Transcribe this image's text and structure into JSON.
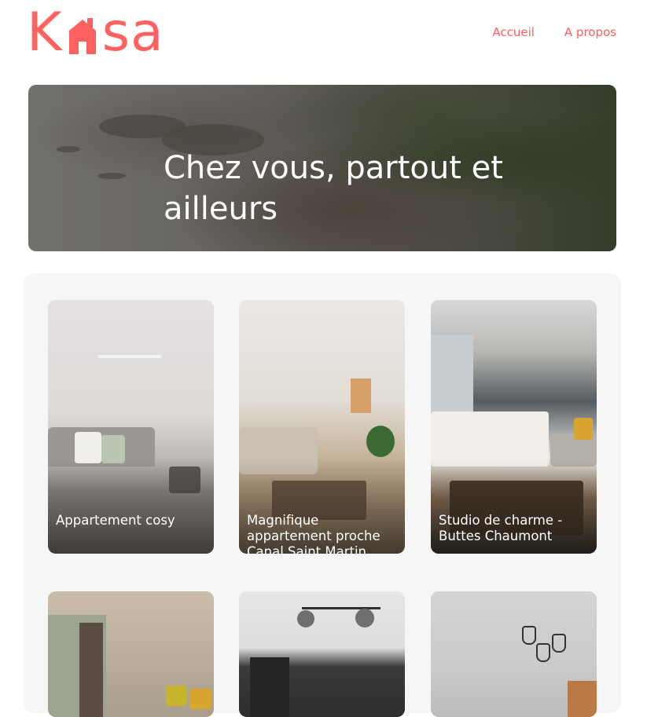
{
  "brand": {
    "logo_text_left": "K",
    "logo_text_right": "sa",
    "logo_icon": "house-icon",
    "color": "#FF6060"
  },
  "nav": {
    "items": [
      {
        "label": "Accueil"
      },
      {
        "label": "A propos"
      }
    ]
  },
  "banner": {
    "title_line1": "Chez vous, partout et",
    "title_line2": "ailleurs"
  },
  "listings": [
    {
      "title": "Appartement cosy"
    },
    {
      "title": "Magnifique appartement proche Canal Saint Martin"
    },
    {
      "title": "Studio de charme - Buttes Chaumont"
    },
    {
      "title": ""
    },
    {
      "title": ""
    },
    {
      "title": ""
    }
  ]
}
